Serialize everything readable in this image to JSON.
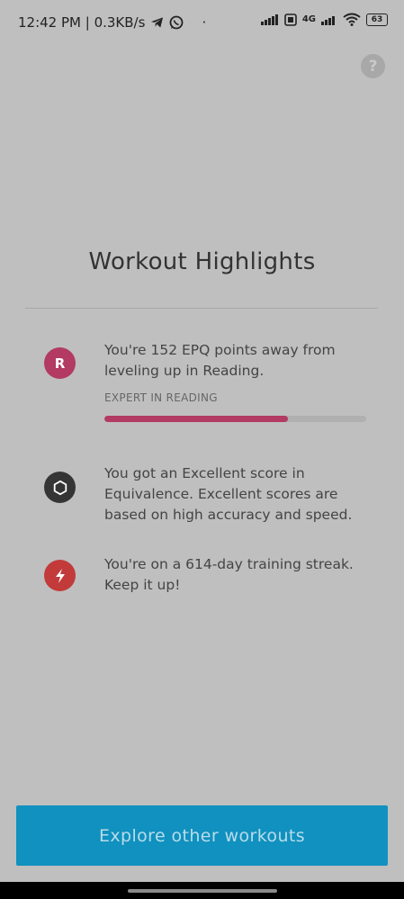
{
  "status_bar": {
    "time_speed": "12:42 PM | 0.3KB/s",
    "dot": "·",
    "network_label": "4G",
    "battery": "63"
  },
  "help": {
    "label": "?"
  },
  "title": "Workout Highlights",
  "highlights": [
    {
      "icon_letter": "R",
      "text": "You're 152 EPQ points away from leveling up in Reading.",
      "sublabel": "EXPERT IN READING",
      "progress": 0.7,
      "color": "#b23a63"
    },
    {
      "icon": "hexagon-icon",
      "text": "You got an Excellent score in Equivalence. Excellent scores are based on high accuracy and speed.",
      "color": "#353535"
    },
    {
      "icon": "lightning-icon",
      "text": "You're on a 614-day training streak. Keep it up!",
      "color": "#c23a3a"
    }
  ],
  "cta": {
    "label": "Explore other workouts"
  }
}
